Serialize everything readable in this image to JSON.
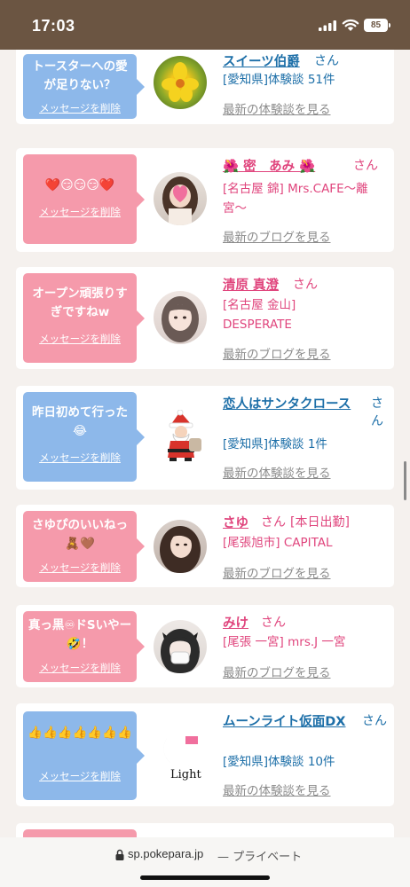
{
  "status_bar": {
    "time": "17:03",
    "battery": "85"
  },
  "items": [
    {
      "message": "トースターへの愛が足りない？",
      "delete_label": "メッセージを削除",
      "name": "スイーツ伯爵",
      "san": "さん",
      "sub": "[愛知県]体験談 51件",
      "more": "最新の体験談を見る",
      "bubble_color": "blue",
      "name_color": "#1d6fa8"
    },
    {
      "message": "❤️😏😏😏❤️",
      "delete_label": "メッセージを削除",
      "name": "🌺 密　あみ 🌺",
      "san": "さん",
      "sub": "[名古屋 錦] Mrs.CAFE〜離宮〜",
      "more": "最新のブログを見る",
      "bubble_color": "pink",
      "name_color": "#e0457d"
    },
    {
      "message": "オープン頑張りすぎですねw",
      "delete_label": "メッセージを削除",
      "name": "清原 真澄",
      "san": "さん",
      "sub": "[名古屋 金山] DESPERATE",
      "more": "最新のブログを見る",
      "bubble_color": "pink",
      "name_color": "#e0457d"
    },
    {
      "message": "昨日初めて行った😂",
      "delete_label": "メッセージを削除",
      "name": "恋人はサンタクロース",
      "san": "さん",
      "sub": "[愛知県]体験談 1件",
      "more": "最新の体験談を見る",
      "bubble_color": "blue",
      "name_color": "#1d6fa8"
    },
    {
      "message": "さゆぴのいいねっ🧸🤎",
      "delete_label": "メッセージを削除",
      "name": "さゆ",
      "san": "さん",
      "status": "[本日出勤]",
      "sub": "[尾張旭市] CAPITAL",
      "more": "最新のブログを見る",
      "bubble_color": "pink",
      "name_color": "#e0457d"
    },
    {
      "message": "真っ黒♾ドSいやー🤣！",
      "delete_label": "メッセージを削除",
      "name": "みけ",
      "san": "さん",
      "sub": "[尾張 一宮] mrs.J 一宮",
      "more": "最新のブログを見る",
      "bubble_color": "pink",
      "name_color": "#e0457d"
    },
    {
      "message": "👍👍👍👍👍👍👍",
      "delete_label": "メッセージを削除",
      "name": "ムーンライト仮面DX",
      "san": "さん",
      "sub": "[愛知県]体験談 10件",
      "more": "最新の体験談を見る",
      "bubble_color": "blue",
      "name_color": "#1d6fa8",
      "logo_text": "Light"
    }
  ],
  "browser": {
    "url": "sp.pokepara.jp",
    "privacy": "— プライベート"
  }
}
